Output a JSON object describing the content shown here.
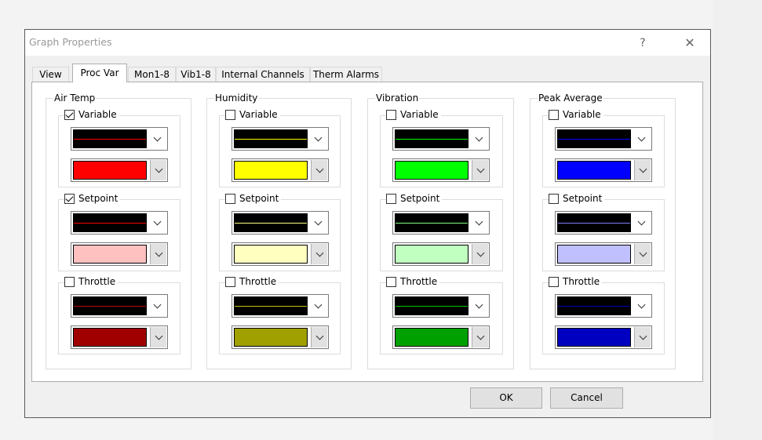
{
  "window": {
    "title": "Graph Properties",
    "help_icon": "?",
    "close_icon": "✕"
  },
  "tabs": [
    {
      "label": "View",
      "active": false
    },
    {
      "label": "Proc Var",
      "active": true
    },
    {
      "label": "Mon1-8",
      "active": false
    },
    {
      "label": "Vib1-8",
      "active": false
    },
    {
      "label": "Internal Channels",
      "active": false
    },
    {
      "label": "Therm Alarms",
      "active": false
    }
  ],
  "groups": [
    {
      "label": "Air Temp",
      "items": [
        {
          "label": "Variable",
          "checked": true,
          "line_color": "#ff0000",
          "color": "#ff0000"
        },
        {
          "label": "Setpoint",
          "checked": true,
          "line_color": "#ff0000",
          "color": "#ffc0c0"
        },
        {
          "label": "Throttle",
          "checked": false,
          "line_color": "#c00000",
          "color": "#a00000"
        }
      ]
    },
    {
      "label": "Humidity",
      "items": [
        {
          "label": "Variable",
          "checked": false,
          "line_color": "#ffff00",
          "color": "#ffff00"
        },
        {
          "label": "Setpoint",
          "checked": false,
          "line_color": "#ffff80",
          "color": "#ffffc0"
        },
        {
          "label": "Throttle",
          "checked": false,
          "line_color": "#c0c000",
          "color": "#a0a000"
        }
      ]
    },
    {
      "label": "Vibration",
      "items": [
        {
          "label": "Variable",
          "checked": false,
          "line_color": "#00ff00",
          "color": "#00ff00"
        },
        {
          "label": "Setpoint",
          "checked": false,
          "line_color": "#80ff80",
          "color": "#c0ffc0"
        },
        {
          "label": "Throttle",
          "checked": false,
          "line_color": "#00c000",
          "color": "#00a000"
        }
      ]
    },
    {
      "label": "Peak Average",
      "items": [
        {
          "label": "Variable",
          "checked": false,
          "line_color": "#0000ff",
          "color": "#0000ff"
        },
        {
          "label": "Setpoint",
          "checked": false,
          "line_color": "#8080ff",
          "color": "#c0c0ff"
        },
        {
          "label": "Throttle",
          "checked": false,
          "line_color": "#0000c0",
          "color": "#0000c0"
        }
      ]
    }
  ],
  "buttons": {
    "ok": "OK",
    "cancel": "Cancel"
  }
}
